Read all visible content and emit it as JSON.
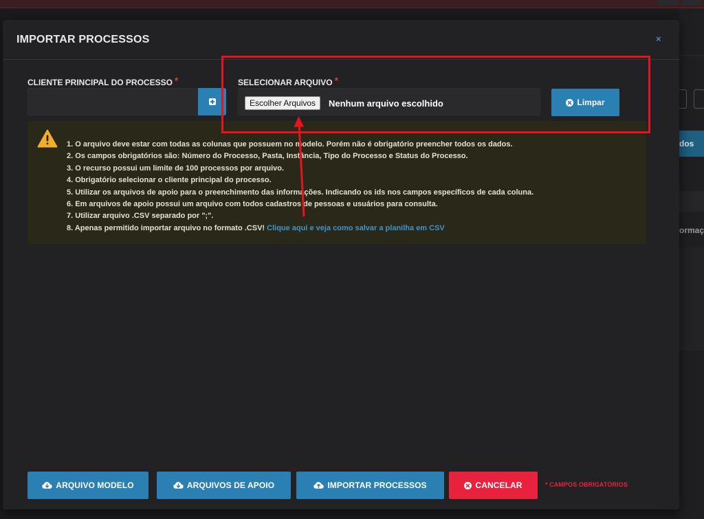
{
  "background": {
    "right_button_text": "dos",
    "right_gray_text": "ormaçõ"
  },
  "modal": {
    "title": "IMPORTAR PROCESSOS",
    "close_label": "×"
  },
  "client_field": {
    "label": "CLIENTE PRINCIPAL DO PROCESSO",
    "required_mark": "*",
    "value": ""
  },
  "file_field": {
    "label": "SELECIONAR ARQUIVO",
    "required_mark": "*",
    "choose_label": "Escolher Arquivos",
    "status_text": "Nenhum arquivo escolhido"
  },
  "clear_button": {
    "label": "Limpar"
  },
  "warning": {
    "items": [
      "1. O arquivo deve estar com todas as colunas que possuem no modelo. Porém não é obrigatório preencher todos os dados.",
      "2. Os campos obrigatórios são: Número do Processo, Pasta, Instância, Tipo do Processo e Status do Processo.",
      "3. O recurso possui um limite de 100 processos por arquivo.",
      "4. Obrigatório selecionar o cliente principal do processo.",
      "5. Utilizar os arquivos de apoio para o preenchimento das informações. Indicando os ids nos campos específicos de cada coluna.",
      "6. Em arquivos de apoio possui um arquivo com todos cadastros de pessoas e usuários para consulta.",
      "7. Utilizar arquivo .CSV separado por \";\"."
    ],
    "last_item_text": "8. Apenas permitido importar arquivo no formato .CSV!",
    "last_item_link": "Clique aqui e veja como salvar a planilha em CSV"
  },
  "footer": {
    "model_label": "ARQUIVO MODELO",
    "support_label": "ARQUIVOS DE APOIO",
    "import_label": "IMPORTAR PROCESSOS",
    "cancel_label": "CANCELAR",
    "required_note": "* CAMPOS OBRIGATÓRIOS"
  },
  "colors": {
    "primary": "#2a7fb3",
    "danger": "#e8213d",
    "annotation": "#e8141d",
    "warning_bg": "#2a2818",
    "warning_icon": "#f0ad2e"
  }
}
